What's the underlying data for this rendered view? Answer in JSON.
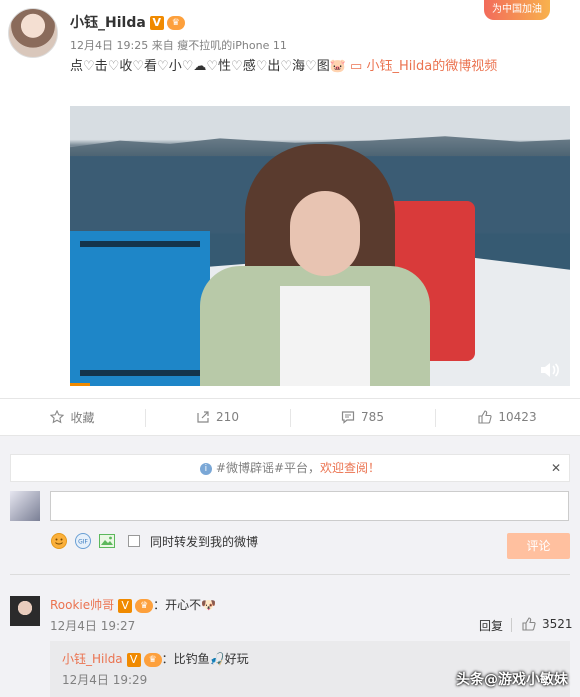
{
  "post": {
    "username": "小钰_Hilda",
    "badge_v": "V",
    "badge_member": "♛",
    "banner": "为中国加油",
    "date": "12月4日 19:25",
    "source_prefix": "来自",
    "source": "瘦不拉叽的iPhone 11",
    "text_chars": [
      "点",
      "击",
      "收",
      "看",
      "小",
      "",
      "性",
      "感",
      "出",
      "海",
      "图"
    ],
    "video_link": "小钰_Hilda的微博视频"
  },
  "actions": {
    "favorite": "收藏",
    "repost": "210",
    "comment": "785",
    "like": "10423"
  },
  "notice": {
    "text_1": "#微博辟谣#平台，",
    "text_2": "欢迎查阅！"
  },
  "composer": {
    "input_value": "",
    "repost_label": "同时转发到我的微博",
    "submit_label": "评论"
  },
  "comment": {
    "username": "Rookie帅哥",
    "text": "：开心不",
    "time": "12月4日 19:27",
    "reply_label": "回复",
    "likes": "3521"
  },
  "sub_comment": {
    "username": "小钰_Hilda",
    "text": "：比钓鱼",
    "text_2": "好玩",
    "time": "12月4日 19:29"
  },
  "watermark": "头条@游戏小敏妹",
  "colors": {
    "link": "#eb7350",
    "meta": "#808080",
    "submit_disabled": "#ffc09f"
  }
}
